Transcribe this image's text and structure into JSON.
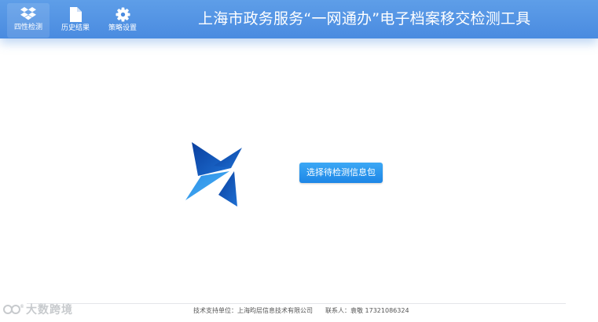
{
  "header": {
    "title": "上海市政务服务“一网通办”电子档案移交检测工具",
    "nav": [
      {
        "label": "四性检测",
        "icon": "dropbox-icon",
        "active": true
      },
      {
        "label": "历史结果",
        "icon": "file-icon",
        "active": false
      },
      {
        "label": "策略设置",
        "icon": "gear-icon",
        "active": false
      }
    ]
  },
  "main": {
    "logo_icon": "pinwheel-logo-icon",
    "select_button_label": "选择待检测信息包"
  },
  "footer": {
    "support": "技术支持单位：上海昀层信息技术有限公司",
    "contact": "联系人：袁敬 17321086324"
  },
  "watermark": {
    "text": "大数跨境"
  },
  "colors": {
    "header": "#4a8be0",
    "button": "#1d86e6",
    "logo_dark": "#0d4fb0",
    "logo_light": "#2e95ea"
  }
}
